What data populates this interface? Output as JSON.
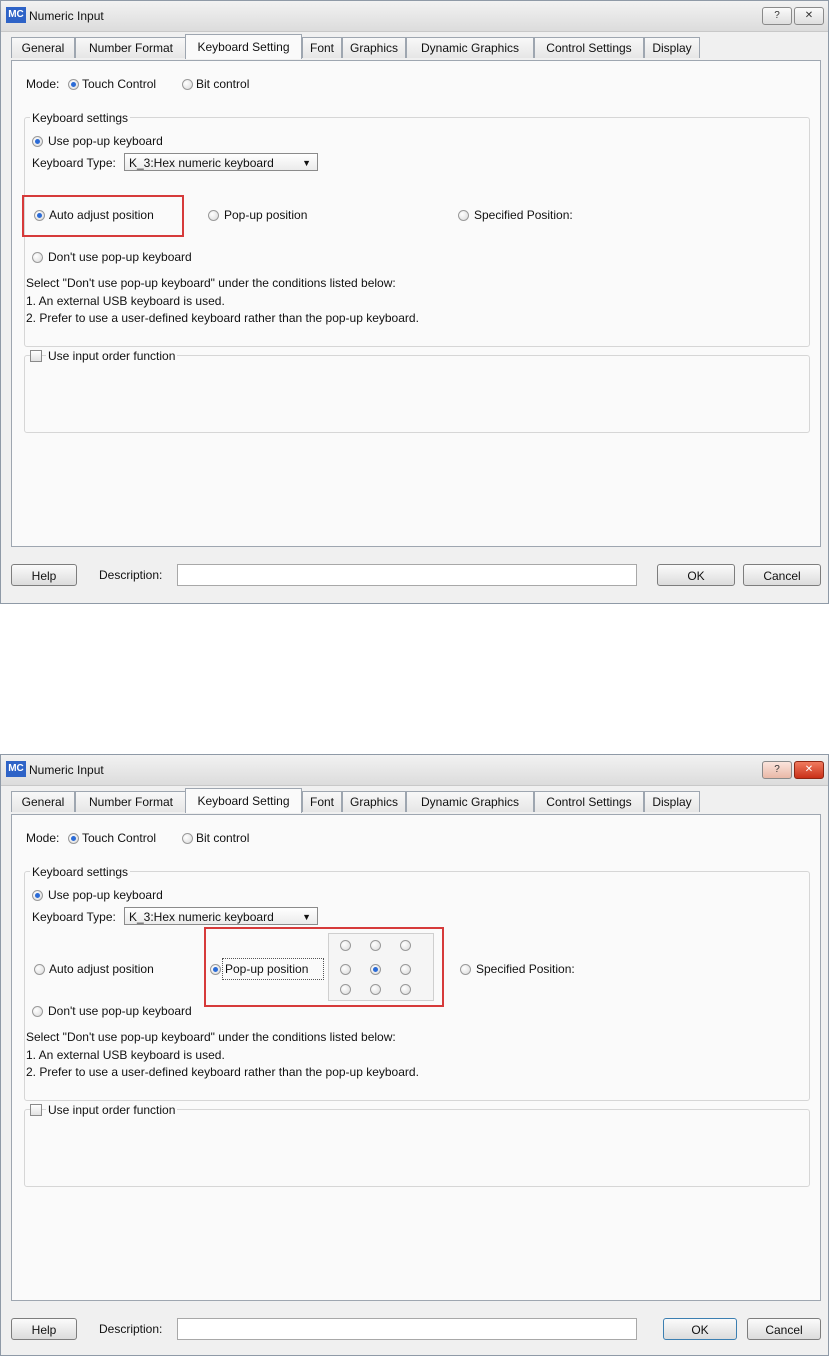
{
  "window": {
    "icon_text": "MC",
    "title": "Numeric Input",
    "help_glyph": "?",
    "close_glyph": "✕"
  },
  "tabs": [
    "General",
    "Number Format",
    "Keyboard Setting",
    "Font",
    "Graphics",
    "Dynamic Graphics",
    "Control Settings",
    "Display"
  ],
  "active_tab": "Keyboard Setting",
  "mode": {
    "label": "Mode:",
    "touch": "Touch Control",
    "bit": "Bit control"
  },
  "keyboard": {
    "group_label": "Keyboard settings",
    "use_popup": "Use pop-up keyboard",
    "type_label": "Keyboard Type:",
    "type_value": "K_3:Hex numeric keyboard",
    "auto_adjust": "Auto adjust position",
    "popup_position": "Pop-up position",
    "specified_position": "Specified Position:",
    "dont_use": "Don't use pop-up keyboard",
    "note_line1": "Select \"Don't use pop-up keyboard\" under the conditions listed below:",
    "note_line2": "1. An external USB keyboard is used.",
    "note_line3": "2. Prefer to use a user-defined keyboard rather than the pop-up keyboard."
  },
  "input_order": {
    "label": "Use input order function"
  },
  "footer": {
    "help": "Help",
    "description_label": "Description:",
    "ok": "OK",
    "cancel": "Cancel"
  },
  "screens": [
    {
      "selected_position_option": "Auto adjust position"
    },
    {
      "selected_position_option": "Pop-up position",
      "popup_grid_selected": "center"
    }
  ],
  "colors": {
    "highlight": "#d63a3a",
    "radio_dot": "#2b6bd6",
    "title_icon": "#2e63c7"
  }
}
